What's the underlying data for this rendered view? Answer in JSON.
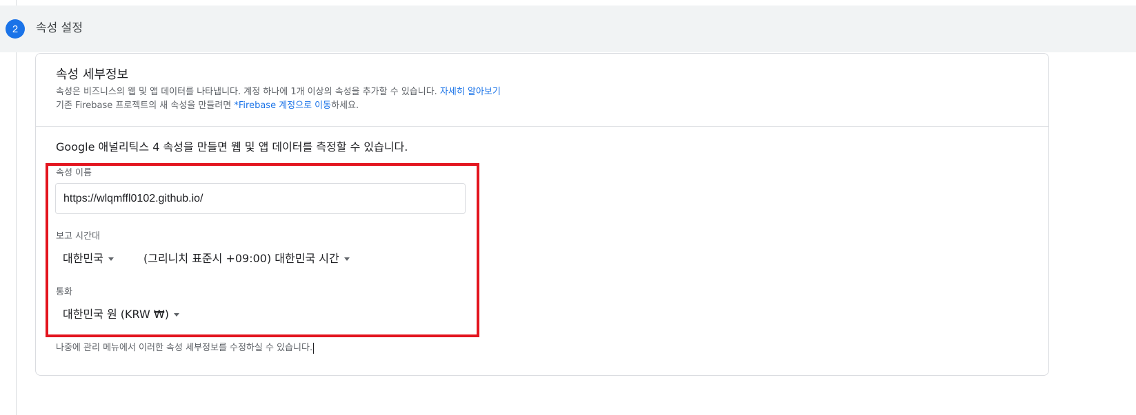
{
  "step": {
    "number": "2",
    "title": "속성 설정"
  },
  "card": {
    "title": "속성 세부정보",
    "desc_line1_text": "속성은 비즈니스의 웹 및 앱 데이터를 나타냅니다. 계정 하나에 1개 이상의 속성을 추가할 수 있습니다. ",
    "desc_line1_link": "자세히 알아보기",
    "desc_line2_prefix": "기존 Firebase 프로젝트의 새 속성을 만들려면 ",
    "desc_line2_link": "*Firebase 계정으로 이동",
    "desc_line2_suffix": "하세요.",
    "intro": "Google 애널리틱스 4 속성을 만들면 웹 및 앱 데이터를 측정할 수 있습니다.",
    "footer_note": "나중에 관리 메뉴에서 이러한 속성 세부정보를 수정하실 수 있습니다."
  },
  "form": {
    "property_name": {
      "label": "속성 이름",
      "value": "https://wlqmffl0102.github.io/"
    },
    "timezone": {
      "label": "보고 시간대",
      "country": "대한민국",
      "zone": "(그리니치 표준시 +09:00) 대한민국 시간"
    },
    "currency": {
      "label": "통화",
      "value": "대한민국 원 (KRW ₩)"
    }
  },
  "colors": {
    "accent": "#1a73e8",
    "highlight": "#e3151f",
    "header_bg": "#f1f3f4"
  }
}
